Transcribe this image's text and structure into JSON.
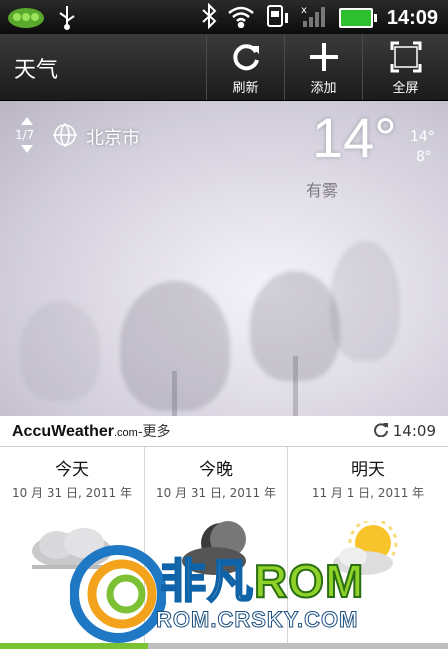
{
  "status_bar": {
    "time": "14:09",
    "icons": [
      "app-notification-icon",
      "usb-icon",
      "bluetooth-icon",
      "wifi-icon",
      "sim-card-icon",
      "signal-icon",
      "battery-icon"
    ]
  },
  "action_bar": {
    "title": "天气",
    "refresh_label": "刷新",
    "add_label": "添加",
    "fullscreen_label": "全屏"
  },
  "weather": {
    "location_index": "1/7",
    "city": "北京市",
    "current_temp": "14°",
    "high": "14°",
    "low": "8°",
    "condition": "有雾"
  },
  "accuweather": {
    "brand": "AccuWeather",
    "brand_suffix": ".com",
    "more": "-更多",
    "updated_time": "14:09"
  },
  "forecast": [
    {
      "title": "今天",
      "date": "10 月 31 日, 2011 年",
      "icon": "fog-cloud-icon"
    },
    {
      "title": "今晚",
      "date": "10 月 31 日, 2011 年",
      "icon": "moon-cloud-icon"
    },
    {
      "title": "明天",
      "date": "11 月 1 日, 2011 年",
      "icon": "sun-cloud-icon"
    }
  ],
  "watermark": {
    "line1_prefix": "非凡",
    "line1_rom": "ROM",
    "line2": "ROM.CRSKY.COM"
  },
  "colors": {
    "accent_green": "#7ac231",
    "battery_green": "#2dbf2d",
    "watermark_blue": "#0f63a8"
  }
}
